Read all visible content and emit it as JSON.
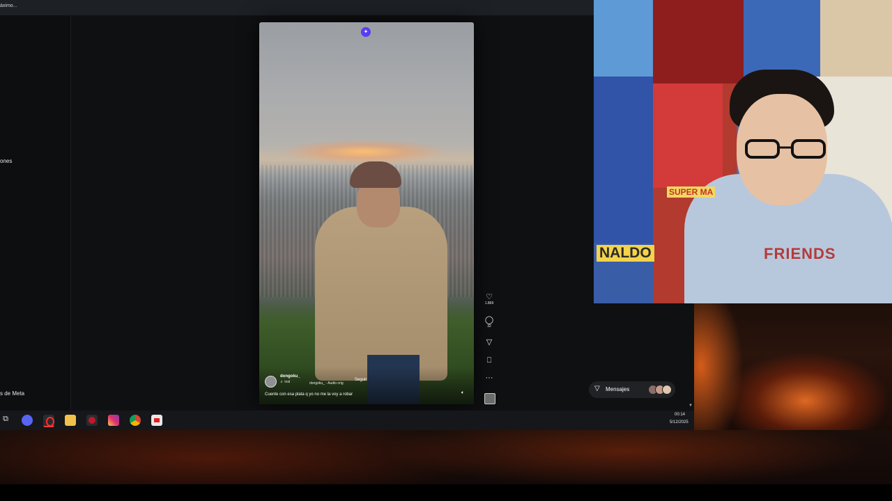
{
  "window": {
    "tab_title": "áximo..."
  },
  "sidebar": {
    "items": [
      {
        "label": "ones"
      },
      {
        "label": "s de Meta"
      }
    ]
  },
  "reel": {
    "username": "dongoku_",
    "user_sub": "♬ inal",
    "audio": "dongoku_ · Audio orig",
    "follow_label": "Seguir",
    "caption": "Cuente con esa plata q yo no me la voy a robar",
    "actions": {
      "likes": "1.869",
      "comments": "32"
    }
  },
  "icons": {
    "like": "heart-icon",
    "comment": "comment-icon",
    "share": "send-icon",
    "save": "bookmark-icon",
    "more": "more-icon",
    "mute": "volume-icon"
  },
  "messages": {
    "label": "Mensajes"
  },
  "taskbar": {
    "apps": [
      "task-view",
      "discord",
      "opera",
      "file-explorer",
      "media-app",
      "instagram",
      "chrome",
      "screen-app"
    ],
    "time": "00:14",
    "date": "5/12/2025"
  },
  "webcam": {
    "shirt_text": "FRIENDS",
    "poster_text_1": "NALDO",
    "poster_text_2": "SUPER MA"
  },
  "colors": {
    "accent": "#5a3df2",
    "background": "#0f1012",
    "taskbar": "#16171a"
  }
}
